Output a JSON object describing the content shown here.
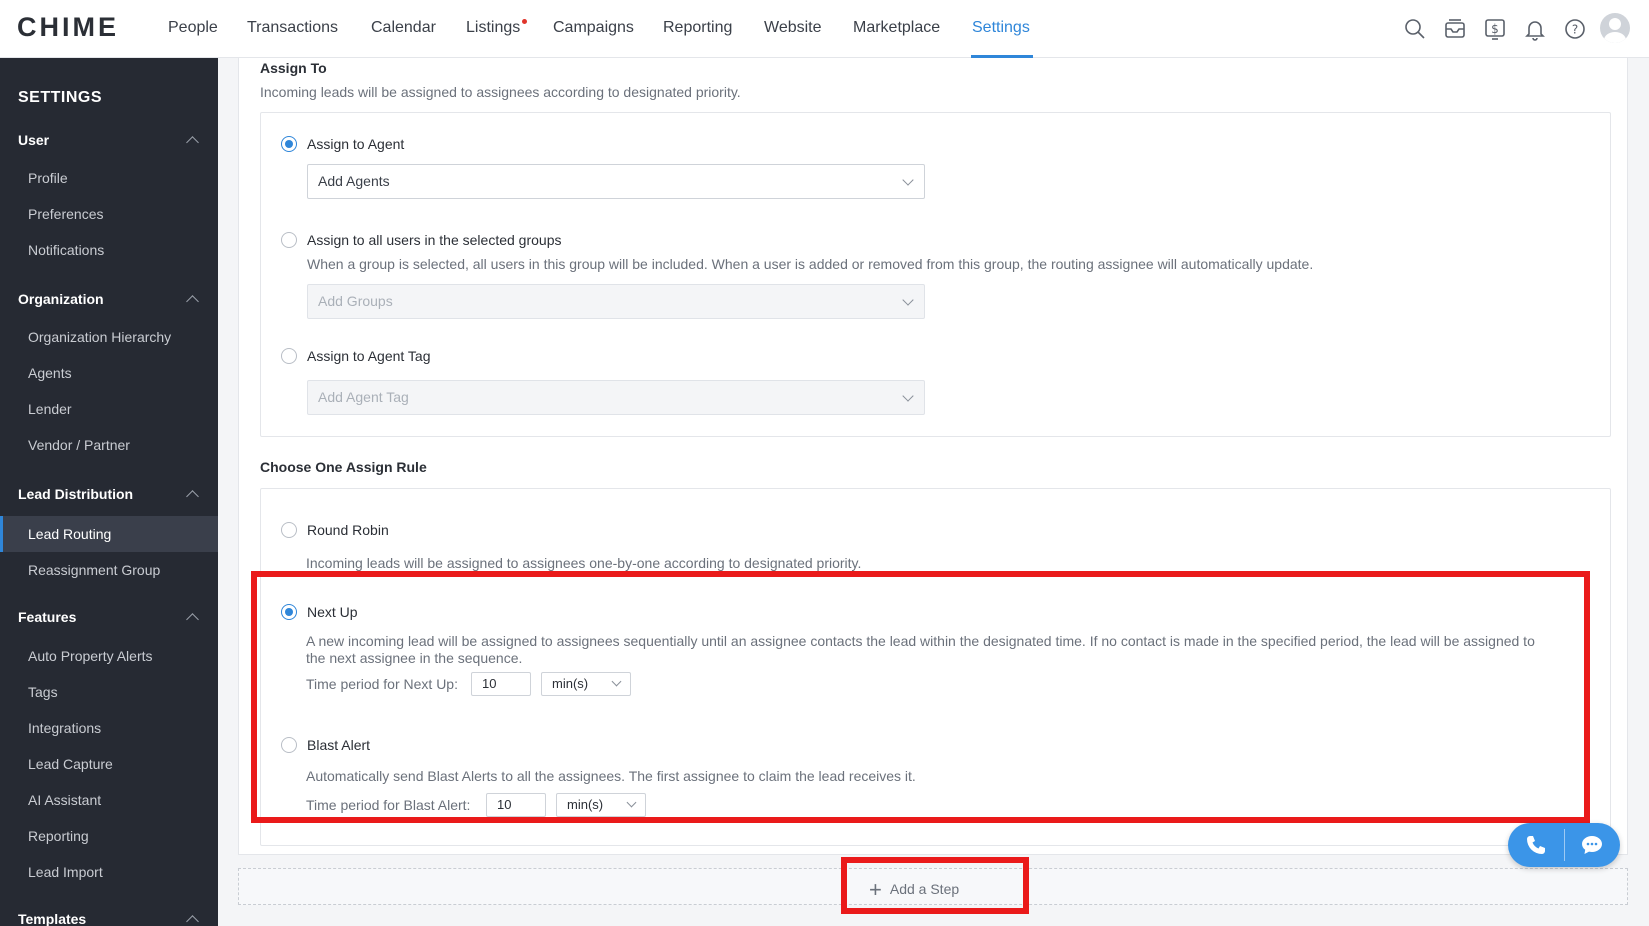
{
  "app": {
    "logo": "CHIME"
  },
  "nav": {
    "items": [
      {
        "label": "People"
      },
      {
        "label": "Transactions"
      },
      {
        "label": "Calendar"
      },
      {
        "label": "Listings"
      },
      {
        "label": "Campaigns"
      },
      {
        "label": "Reporting"
      },
      {
        "label": "Website"
      },
      {
        "label": "Marketplace"
      },
      {
        "label": "Settings"
      }
    ],
    "active": "Settings",
    "icons": [
      "search-icon",
      "inbox-icon",
      "dollar-icon",
      "bell-icon",
      "help-icon",
      "avatar"
    ]
  },
  "sidebar": {
    "title": "SETTINGS",
    "sections": [
      {
        "label": "User",
        "items": [
          "Profile",
          "Preferences",
          "Notifications"
        ]
      },
      {
        "label": "Organization",
        "items": [
          "Organization Hierarchy",
          "Agents",
          "Lender",
          "Vendor / Partner"
        ]
      },
      {
        "label": "Lead Distribution",
        "items": [
          "Lead Routing",
          "Reassignment Group"
        ]
      },
      {
        "label": "Features",
        "items": [
          "Auto Property Alerts",
          "Tags",
          "Integrations",
          "Lead Capture",
          "AI Assistant",
          "Reporting",
          "Lead Import"
        ]
      },
      {
        "label": "Templates",
        "items": []
      }
    ],
    "active_item": "Lead Routing"
  },
  "assign_to": {
    "title": "Assign To",
    "subtitle": "Incoming leads will be assigned to assignees according to designated priority.",
    "options": [
      {
        "label": "Assign to Agent",
        "selected": true,
        "select_placeholder": "Add Agents"
      },
      {
        "label": "Assign to all users in the selected groups",
        "selected": false,
        "description": "When a group is selected, all users in this group will be included. When a user is added or removed from this group, the routing assignee will automatically update.",
        "select_placeholder": "Add Groups"
      },
      {
        "label": "Assign to Agent Tag",
        "selected": false,
        "select_placeholder": "Add Agent Tag"
      }
    ]
  },
  "assign_rule": {
    "title": "Choose One Assign Rule",
    "options": [
      {
        "label": "Round Robin",
        "selected": false,
        "description": "Incoming leads will be assigned to assignees one-by-one according to designated priority."
      },
      {
        "label": "Next Up",
        "selected": true,
        "description": "A new incoming lead will be assigned to assignees sequentially until an assignee contacts the lead within the designated time. If no contact is made in the specified period, the lead will be assigned to the next assignee in the sequence.",
        "period_label": "Time period for Next Up:",
        "period_value": "10",
        "period_unit": "min(s)"
      },
      {
        "label": "Blast Alert",
        "selected": false,
        "description": "Automatically send Blast Alerts to all the assignees. The first assignee to claim the lead receives it.",
        "period_label": "Time period for Blast Alert:",
        "period_value": "10",
        "period_unit": "min(s)"
      }
    ]
  },
  "add_step": {
    "label": "Add a Step"
  },
  "colors": {
    "accent": "#2f86d9",
    "highlight": "#ea1a1a",
    "sidebar_bg": "#262a33"
  }
}
